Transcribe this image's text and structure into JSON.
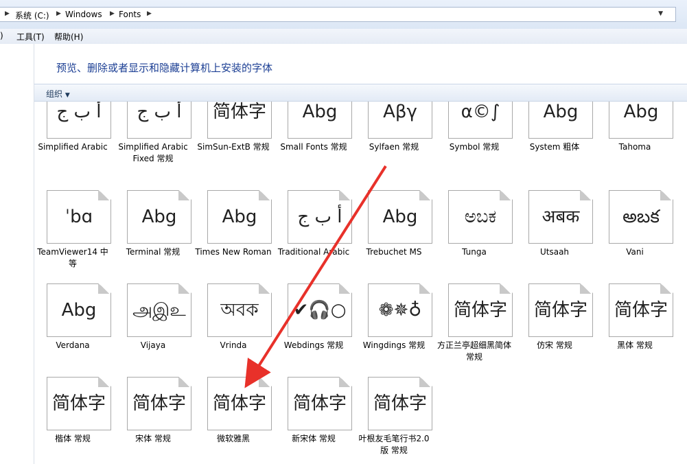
{
  "address": {
    "crumbs": [
      "系统 (C:)",
      "Windows",
      "Fonts"
    ]
  },
  "menubar": {
    "items": [
      "工具(T)",
      "帮助(H)"
    ]
  },
  "header": {
    "title": "预览、删除或者显示和隐藏计算机上安装的字体"
  },
  "cmdbar": {
    "organize_label": "组织"
  },
  "fonts": [
    {
      "name": "Simplified Arabic",
      "sample": "أ ب ج"
    },
    {
      "name": "Simplified Arabic Fixed 常规",
      "sample": "أ ب ج"
    },
    {
      "name": "SimSun-ExtB 常规",
      "sample": "简体字"
    },
    {
      "name": "Small Fonts 常规",
      "sample": "Abg"
    },
    {
      "name": "Sylfaen 常规",
      "sample": "Aβγ"
    },
    {
      "name": "Symbol 常规",
      "sample": "α©∫"
    },
    {
      "name": "System 粗体",
      "sample": "Abg"
    },
    {
      "name": "Tahoma",
      "sample": "Abg"
    },
    {
      "name": "TeamViewer14 中等",
      "sample": "ˈbɑ"
    },
    {
      "name": "Terminal 常规",
      "sample": "Abg"
    },
    {
      "name": "Times New Roman",
      "sample": "Abg"
    },
    {
      "name": "Traditional Arabic",
      "sample": "أ ب ج"
    },
    {
      "name": "Trebuchet MS",
      "sample": "Abg"
    },
    {
      "name": "Tunga",
      "sample": "ಅಬಕ"
    },
    {
      "name": "Utsaah",
      "sample": "अबक"
    },
    {
      "name": "Vani",
      "sample": "అబక"
    },
    {
      "name": "Verdana",
      "sample": "Abg"
    },
    {
      "name": "Vijaya",
      "sample": "அஇஉ"
    },
    {
      "name": "Vrinda",
      "sample": "অবক"
    },
    {
      "name": "Webdings 常规",
      "sample": "✔🎧○"
    },
    {
      "name": "Wingdings 常规",
      "sample": "❁✵♁"
    },
    {
      "name": "方正兰亭超细黑简体 常规",
      "sample": "简体字"
    },
    {
      "name": "仿宋 常规",
      "sample": "简体字"
    },
    {
      "name": "黑体 常规",
      "sample": "简体字"
    },
    {
      "name": "楷体 常规",
      "sample": "简体字"
    },
    {
      "name": "宋体 常规",
      "sample": "简体字"
    },
    {
      "name": "微软雅黑",
      "sample": "简体字"
    },
    {
      "name": "新宋体 常规",
      "sample": "简体字"
    },
    {
      "name": "叶根友毛笔行书2.0版 常规",
      "sample": "简体字"
    }
  ],
  "colors": {
    "title": "#1c3f94",
    "arrow": "#e8312a"
  }
}
